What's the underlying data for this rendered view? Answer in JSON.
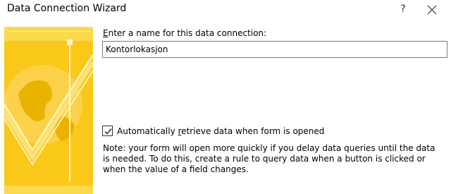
{
  "window": {
    "title": "Data Connection Wizard",
    "help_label": "?"
  },
  "form": {
    "name_label_accel": "E",
    "name_label_rest": "nter a name for this data connection:",
    "name_value": "Kontorlokasjon",
    "checkbox_checked": true,
    "checkbox_label_pre": "Automatically ",
    "checkbox_label_accel": "r",
    "checkbox_label_post": "etrieve data when form is opened",
    "note": "Note: your form will open more quickly if you delay data queries until the data is needed. To do this, create a rule to query data when a button is clicked or when the value of a field changes."
  },
  "colors": {
    "art_bg": "#f9c819",
    "art_light": "#fbd94d",
    "art_dark": "#e6a800",
    "art_white": "#fff6c8"
  }
}
